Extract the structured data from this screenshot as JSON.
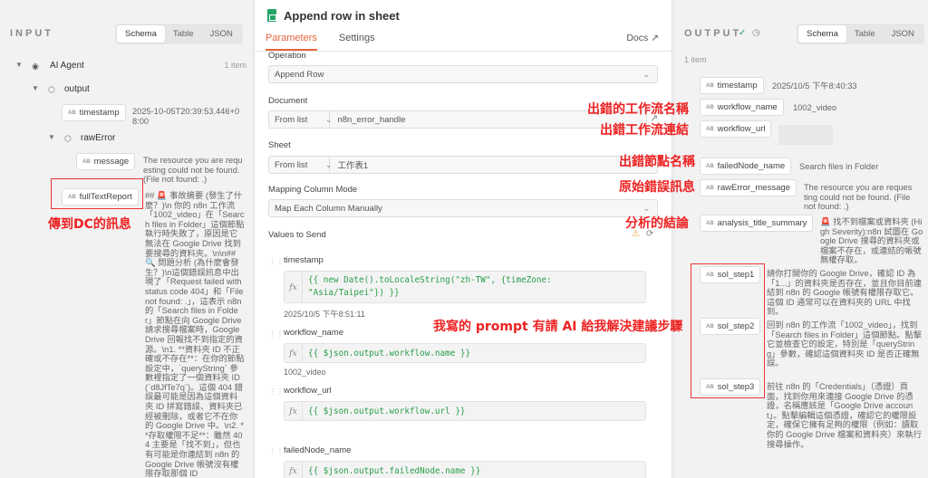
{
  "input": {
    "title": "INPUT",
    "tabs": [
      "Schema",
      "Table",
      "JSON"
    ],
    "node": {
      "name": "AI Agent",
      "count": "1 item"
    },
    "output_label": "output",
    "timestamp": {
      "key": "timestamp",
      "value": "2025-10-05T20:39:53.446+08:00"
    },
    "rawError": "rawError",
    "message": {
      "key": "message",
      "value": "The resource you are requesting could not be found. (File not found: .)"
    },
    "fullTextReport": {
      "key": "fullTextReport",
      "value": "## 🚨 事故摘要 (發生了什麼？)\\n 你的 n8n 工作流「1002_video」在「Search files in Folder」這個節點執行時失敗了，原因是它無法在 Google Drive 找到要搜尋的資料夾。\\n\\n## 🔍 問題分析 (為什麼會發生？)\\n這個錯誤訊息中出現了「Request failed with status code 404」和「File not found: .」，這表示 n8n 的「Search files in Folder」節點在向 Google Drive 請求搜尋檔案時，Google Drive 回報找不到指定的資源。\\n1. **資料夾 ID 不正確或不存在**：在你的節點設定中，`queryString` 參數裡指定了一個資料夾 ID (`d8JfTe7q`)。這個 404 錯誤最可能是因為這個資料夾 ID 拼寫錯誤、資料夾已經被刪除，或者它不在你的 Google Drive 中。\\n2. **存取權限不足**：雖然 404 主要是「找不到」，但也有可能是你連結到 n8n 的 Google Drive 帳號沒有權限存取那個 ID"
    }
  },
  "center": {
    "title": "Append row in sheet",
    "tabs": {
      "parameters": "Parameters",
      "settings": "Settings",
      "docs": "Docs"
    },
    "operation": {
      "label": "Operation",
      "value": "Append Row"
    },
    "document": {
      "label": "Document",
      "mode": "From list",
      "value": "n8n_error_handle"
    },
    "sheet": {
      "label": "Sheet",
      "mode": "From list",
      "value": "工作表1"
    },
    "mapping": {
      "label": "Mapping Column Mode",
      "value": "Map Each Column Manually"
    },
    "values_label": "Values to Send",
    "fields": [
      {
        "name": "timestamp",
        "expr": "{{ new Date().toLocaleString(\"zh-TW\", {timeZone: \"Asia/Taipei\"}) }}",
        "result": "2025/10/5 下午8:51:11"
      },
      {
        "name": "workflow_name",
        "expr": "{{ $json.output.workflow.name }}",
        "result": "1002_video"
      },
      {
        "name": "workflow_url",
        "expr": "{{ $json.output.workflow.url }}",
        "result": ""
      },
      {
        "name": "failedNode_name",
        "expr": "{{ $json.output.failedNode.name }}",
        "result": ""
      }
    ]
  },
  "output": {
    "title": "OUTPUT",
    "tabs": [
      "Schema",
      "Table",
      "JSON"
    ],
    "count": "1 item",
    "rows": [
      {
        "key": "timestamp",
        "value": "2025/10/5 下午8:40:33"
      },
      {
        "key": "workflow_name",
        "value": "1002_video"
      },
      {
        "key": "workflow_url",
        "value": ""
      },
      {
        "key": "failedNode_name",
        "value": "Search files in Folder"
      },
      {
        "key": "rawError_message",
        "value": "The resource you are requesting could not be found. (File not found: .)"
      },
      {
        "key": "analysis_title_summary",
        "value": "🚨 找不到檔案或資料夾 (High Severity):n8n 試圖在 Google Drive 搜尋的資料夾或檔案不存在，或連結的帳號無權存取。"
      },
      {
        "key": "sol_step1",
        "value": "請你打開你的 Google Drive，確認 ID 為「1...」的資料夾是否存在，並且你目前連結到 n8n 的 Google 帳號有權限存取它。這個 ID 通常可以在資料夾的 URL 中找到。"
      },
      {
        "key": "sol_step2",
        "value": "回到 n8n 的工作流「1002_video」，找到「Search files in Folder」這個節點。點擊它並檢查它的設定，特別是「queryString」參數，確認這個資料夾 ID 是否正確無誤。"
      },
      {
        "key": "sol_step3",
        "value": "前往 n8n 的「Credentials」（憑證）頁面，找到你用來連接 Google Drive 的憑證，名稱應該是「Google Drive account」。點擊編輯這個憑證，確認它的權限設定，確保它擁有足夠的權限（例如：讀取你的 Google Drive 檔案和資料夾）來執行搜尋操作。"
      }
    ]
  },
  "annotations": {
    "dc_message": "傳到DC的訊息",
    "workflow_name": "出錯的工作流名稱",
    "workflow_link": "出錯工作流連結",
    "node_name": "出錯節點名稱",
    "raw_error": "原始錯誤訊息",
    "analysis": "分析的結論",
    "prompt_note": "我寫的 prompt 有請 AI 給我解決建議步驟"
  },
  "colors": {
    "accent": "#e8643e",
    "annotation": "#e22222",
    "expression": "#2aa04a"
  }
}
